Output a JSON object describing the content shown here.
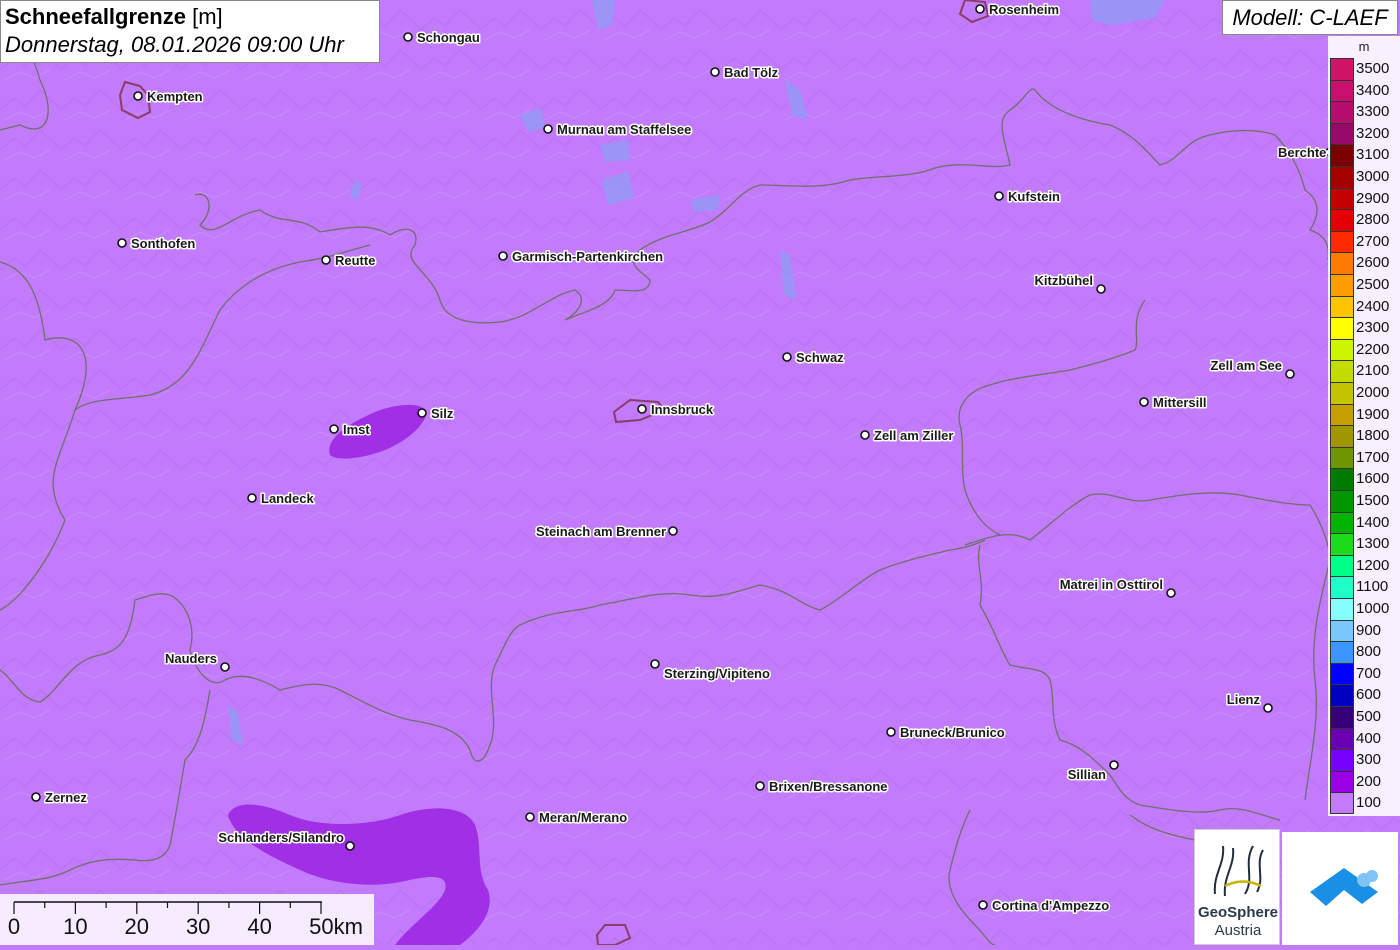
{
  "title": {
    "main": "Schneefallgrenze",
    "unit": "[m]",
    "datetime": "Donnerstag, 08.01.2026 09:00 Uhr"
  },
  "model": "Modell: C-LAEF",
  "legend": {
    "unit": "m",
    "entries": [
      {
        "label": "3500",
        "color": "#d01466"
      },
      {
        "label": "3400",
        "color": "#c8106e"
      },
      {
        "label": "3300",
        "color": "#b60e6e"
      },
      {
        "label": "3200",
        "color": "#980a6a"
      },
      {
        "label": "3100",
        "color": "#7a0000"
      },
      {
        "label": "3000",
        "color": "#a40000"
      },
      {
        "label": "2900",
        "color": "#c40000"
      },
      {
        "label": "2800",
        "color": "#e20000"
      },
      {
        "label": "2700",
        "color": "#ff2a00"
      },
      {
        "label": "2600",
        "color": "#ff7a00"
      },
      {
        "label": "2500",
        "color": "#ff9c00"
      },
      {
        "label": "2400",
        "color": "#ffc400"
      },
      {
        "label": "2300",
        "color": "#ffff00"
      },
      {
        "label": "2200",
        "color": "#cdf500"
      },
      {
        "label": "2100",
        "color": "#c3dc00"
      },
      {
        "label": "2000",
        "color": "#c4c400"
      },
      {
        "label": "1900",
        "color": "#c4a000"
      },
      {
        "label": "1800",
        "color": "#a09600"
      },
      {
        "label": "1700",
        "color": "#6e9600"
      },
      {
        "label": "1600",
        "color": "#007a00"
      },
      {
        "label": "1500",
        "color": "#009600"
      },
      {
        "label": "1400",
        "color": "#00b400"
      },
      {
        "label": "1300",
        "color": "#1cdc1c"
      },
      {
        "label": "1200",
        "color": "#00ff88"
      },
      {
        "label": "1100",
        "color": "#1effc8"
      },
      {
        "label": "1000",
        "color": "#86ffff"
      },
      {
        "label": "900",
        "color": "#78c8ff"
      },
      {
        "label": "800",
        "color": "#3c96ff"
      },
      {
        "label": "700",
        "color": "#0000ff"
      },
      {
        "label": "600",
        "color": "#0000c0"
      },
      {
        "label": "500",
        "color": "#36007a"
      },
      {
        "label": "400",
        "color": "#6a00b4"
      },
      {
        "label": "300",
        "color": "#7800ff"
      },
      {
        "label": "200",
        "color": "#9a00e6"
      },
      {
        "label": "100",
        "color": "#c27bfb"
      }
    ]
  },
  "cities": [
    {
      "name": "Rosenheim"
    },
    {
      "name": "Schongau"
    },
    {
      "name": "Kempten"
    },
    {
      "name": "Bad Tölz"
    },
    {
      "name": "Murnau am Staffelsee"
    },
    {
      "name": "Berchte"
    },
    {
      "name": "Kufstein"
    },
    {
      "name": "Sonthofen"
    },
    {
      "name": "Reutte"
    },
    {
      "name": "Garmisch-Partenkirchen"
    },
    {
      "name": "Kitzbühel"
    },
    {
      "name": "Schwaz"
    },
    {
      "name": "Zell am See"
    },
    {
      "name": "Mittersill"
    },
    {
      "name": "Silz"
    },
    {
      "name": "Innsbruck"
    },
    {
      "name": "Imst"
    },
    {
      "name": "Zell am Ziller"
    },
    {
      "name": "Landeck"
    },
    {
      "name": "Steinach am Brenner"
    },
    {
      "name": "Matrei in Osttirol"
    },
    {
      "name": "Nauders"
    },
    {
      "name": "Sterzing/Vipiteno"
    },
    {
      "name": "Lienz"
    },
    {
      "name": "Bruneck/Brunico"
    },
    {
      "name": "Sillian"
    },
    {
      "name": "Zernez"
    },
    {
      "name": "Brixen/Bressanone"
    },
    {
      "name": "Schlanders/Silandro"
    },
    {
      "name": "Meran/Merano"
    },
    {
      "name": "Cortina d'Ampezzo"
    }
  ],
  "scale": {
    "labels": [
      "0",
      "10",
      "20",
      "30",
      "40",
      "50km"
    ]
  },
  "logo": {
    "line1": "GeoSphere",
    "line2": "Austria"
  },
  "colors": {
    "base_fill": "#c27bfb",
    "darker_fill": "#9a22e0",
    "border": "#6f6f6f",
    "water": "#8aa0f5"
  }
}
